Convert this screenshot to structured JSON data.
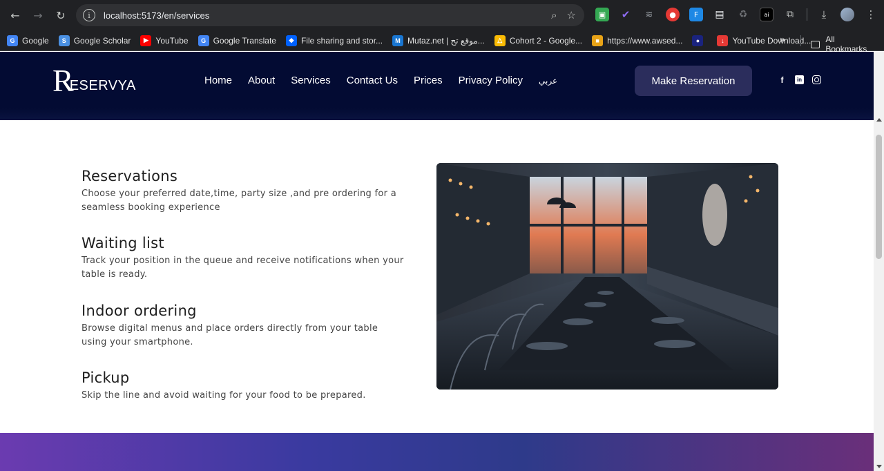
{
  "browser": {
    "url": "localhost:5173/en/services",
    "bookmarks": [
      {
        "label": "Google",
        "color": "#4285f4",
        "icon": "G"
      },
      {
        "label": "Google Scholar",
        "color": "#4a90e2",
        "icon": "S"
      },
      {
        "label": "YouTube",
        "color": "#ff0000",
        "icon": "▶"
      },
      {
        "label": "Google Translate",
        "color": "#4285f4",
        "icon": "G"
      },
      {
        "label": "File sharing and stor...",
        "color": "#0061fe",
        "icon": "◆"
      },
      {
        "label": "Mutaz.net | موقع تح...",
        "color": "#1976d2",
        "icon": "M"
      },
      {
        "label": "Cohort 2 - Google...",
        "color": "#fbbc04",
        "icon": "△"
      },
      {
        "label": "https://www.awsed...",
        "color": "#e8a317",
        "icon": "■"
      },
      {
        "label": "",
        "color": "#1a237e",
        "icon": "●"
      },
      {
        "label": "YouTube Download...",
        "color": "#e53935",
        "icon": "↓"
      }
    ],
    "bookmarks_more": "»",
    "all_bookmarks": "All Bookmarks"
  },
  "site": {
    "logo_letter": "R",
    "logo_text": "ESERVYA",
    "nav": [
      "Home",
      "About",
      "Services",
      "Contact Us",
      "Prices",
      "Privacy Policy",
      "عربي"
    ],
    "cta": "Make Reservation",
    "social": [
      "facebook-icon",
      "linkedin-icon",
      "instagram-icon"
    ],
    "header_color": "#030b33"
  },
  "services": [
    {
      "title": "Reservations",
      "desc": "Choose your preferred date,time, party size ,and pre ordering for a seamless booking experience"
    },
    {
      "title": "Waiting list",
      "desc": "Track your position in the queue and receive notifications when your table is ready."
    },
    {
      "title": "Indoor ordering",
      "desc": "Browse digital menus and place orders directly from your table using your smartphone."
    },
    {
      "title": "Pickup",
      "desc": "Skip the line and avoid waiting for your food to be prepared."
    }
  ]
}
